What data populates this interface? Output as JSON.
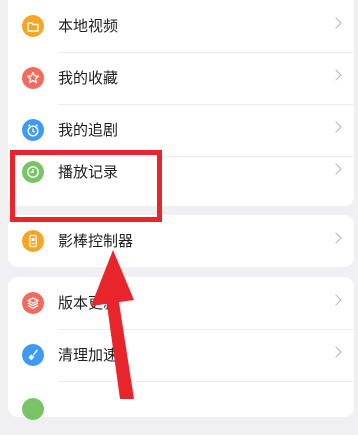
{
  "menu_group_1": [
    {
      "label": "本地视频",
      "icon": "folder-icon",
      "color": "#f6a623"
    },
    {
      "label": "我的收藏",
      "icon": "star-icon",
      "color": "#f36b5c"
    },
    {
      "label": "我的追剧",
      "icon": "alarm-clock-icon",
      "color": "#3f9bf1"
    },
    {
      "label": "播放记录",
      "icon": "clock-icon",
      "color": "#78c466"
    }
  ],
  "menu_group_2": [
    {
      "label": "影棒控制器",
      "icon": "remote-control-icon",
      "color": "#f6a623"
    }
  ],
  "menu_group_3": [
    {
      "label": "版本更新",
      "icon": "layers-icon",
      "color": "#f36b5c"
    },
    {
      "label": "清理加速",
      "icon": "broom-icon",
      "color": "#3f9bf1"
    },
    {
      "label": "",
      "icon": "circle-icon",
      "color": "#78c466"
    }
  ],
  "annotation": {
    "highlight_color": "#e8252b",
    "arrow_color": "#e8252b"
  }
}
